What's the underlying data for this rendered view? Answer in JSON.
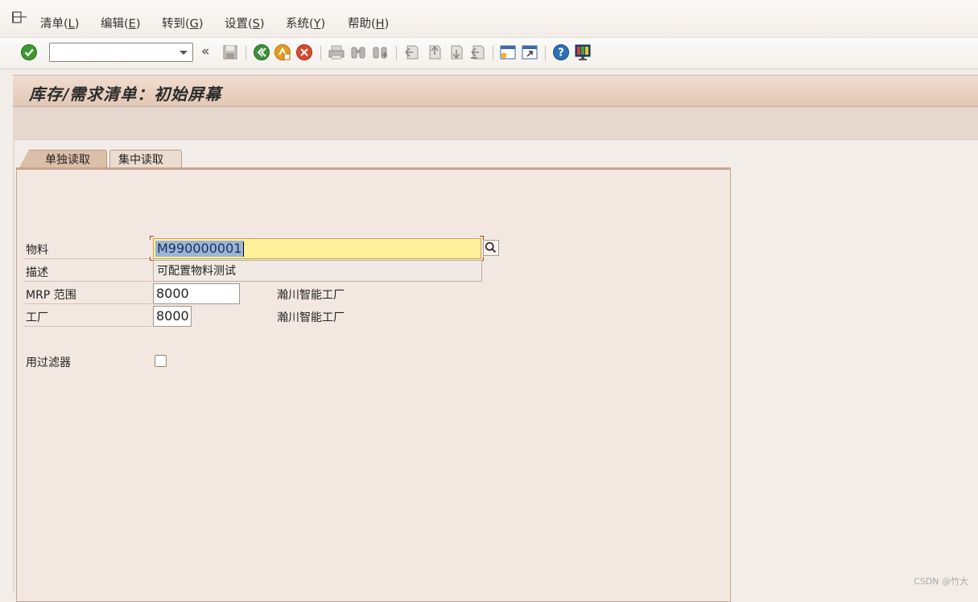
{
  "menu": {
    "items": [
      {
        "text": "清单(",
        "key": "L",
        "close": ")"
      },
      {
        "text": "编辑(",
        "key": "E",
        "close": ")"
      },
      {
        "text": "转到(",
        "key": "G",
        "close": ")"
      },
      {
        "text": "设置(",
        "key": "S",
        "close": ")"
      },
      {
        "text": "系统(",
        "key": "Y",
        "close": ")"
      },
      {
        "text": "帮助(",
        "key": "H",
        "close": ")"
      }
    ]
  },
  "toolbar": {
    "command_value": "",
    "back_symbol": "«",
    "icons": [
      "enter-icon",
      "save-icon",
      "back-icon",
      "exit-icon",
      "cancel-icon",
      "print-icon",
      "find-icon",
      "find-next-icon",
      "first-page-icon",
      "previous-page-icon",
      "next-page-icon",
      "last-page-icon",
      "create-session-icon",
      "shortcut-icon",
      "help-icon",
      "customize-layout-icon"
    ]
  },
  "title": "库存/需求清单：初始屏幕",
  "tabs": [
    {
      "label": "单独读取",
      "active": true
    },
    {
      "label": "集中读取",
      "active": false
    }
  ],
  "form": {
    "material_label": "物料",
    "material_value": "M990000001",
    "description_label": "描述",
    "description_value": "可配置物料测试",
    "mrp_area_label": "MRP 范围",
    "mrp_area_value": "8000",
    "mrp_area_text": "瀚川智能工厂",
    "plant_label": "工厂",
    "plant_value": "8000",
    "plant_text": "瀚川智能工厂",
    "filter_label": "用过滤器",
    "filter_checked": false
  },
  "watermark": "CSDN @竹大",
  "colors": {
    "background": "#f3ede9",
    "title_bar": "#e2c7b5",
    "focused_field": "#fff19a",
    "selection": "#9bb5d6",
    "enter_green": "#3c9a2e",
    "back_green": "#3a8f3a",
    "exit_orange": "#e89a1c",
    "cancel_red": "#d9482b",
    "help_blue": "#2f6fb5"
  }
}
